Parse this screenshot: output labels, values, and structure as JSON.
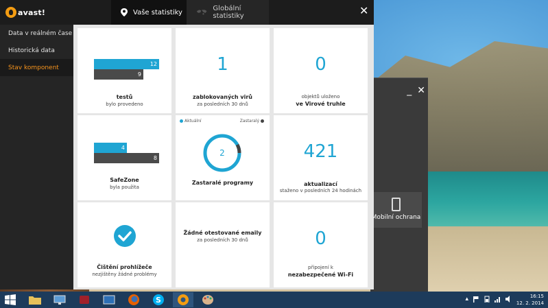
{
  "app": {
    "logo_text": "avast!"
  },
  "tabs": [
    {
      "label": "Vaše statistiky",
      "icon": "location-pin-icon"
    },
    {
      "label": "Globální statistiky",
      "icon": "world-map-icon"
    }
  ],
  "close_label": "✕",
  "sidebar": {
    "items": [
      {
        "label": "Data v reálném čase"
      },
      {
        "label": "Historická data"
      },
      {
        "label": "Stav komponent"
      }
    ]
  },
  "cards": {
    "tests": {
      "bar_a": "12",
      "bar_b": "9",
      "title": "testů",
      "sub": "bylo provedeno"
    },
    "blocked": {
      "value": "1",
      "title": "zablokovaných virů",
      "sub": "za posledních 30 dnů"
    },
    "chest": {
      "value": "0",
      "sub": "objektů uloženo",
      "title": "ve Virové truhle"
    },
    "safezone": {
      "bar_a": "4",
      "bar_b": "8",
      "title": "SafeZone",
      "sub": "byla použita"
    },
    "programs": {
      "legend_left": "Aktuální",
      "legend_right": "Zastaralý",
      "value": "2",
      "title": "Zastaralé programy"
    },
    "updates": {
      "value": "421",
      "title": "aktualizací",
      "sub": "staženo v posledních 24 hodinách"
    },
    "browser": {
      "title": "Čištění prohlížeče",
      "sub": "nezjištěny žádné problémy"
    },
    "emails": {
      "title": "Žádné otestované emaily",
      "sub": "za posledních 30 dnů"
    },
    "wifi": {
      "value": "0",
      "sub": "připojení k",
      "title": "nezabezpečené Wi-Fi"
    }
  },
  "bg_window": {
    "tile_label": "Mobilní ochrana",
    "controls": [
      "_",
      "✕"
    ]
  },
  "taskbar": {
    "clock_time": "16:15",
    "clock_date": "12. 2. 2014"
  },
  "colors": {
    "accent": "#1fa5d3",
    "orange": "#f7941d",
    "dark_bar": "#4a4a4a"
  }
}
